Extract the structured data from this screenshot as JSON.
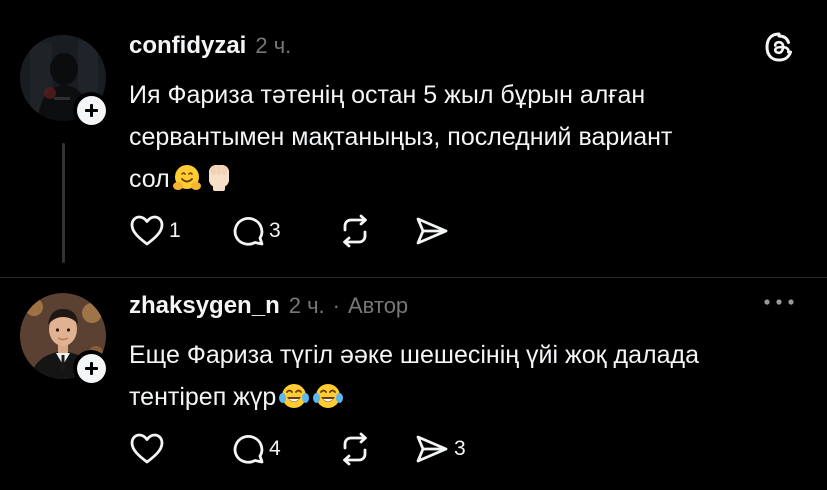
{
  "posts": [
    {
      "username": "confidyzai",
      "time": "2 ч.",
      "author_tag": "",
      "text_lines": [
        "Ия Фариза тәтенің остан 5 жыл бұрын алған",
        "сервантымен мақтаныңыз, последний вариант",
        "сол"
      ],
      "emojis": [
        "hugging-face-emoji",
        "raised-fist-emoji"
      ],
      "likes": "1",
      "replies": "3",
      "reposts": "",
      "shares": ""
    },
    {
      "username": "zhaksygen_n",
      "time": "2 ч.",
      "separator": "·",
      "author_tag": "Автор",
      "text_lines": [
        "Еще Фариза түгіл әәке шешесінің үйі жоқ далада",
        "тентіреп жүр"
      ],
      "emojis": [
        "tears-of-joy-emoji",
        "tears-of-joy-emoji"
      ],
      "likes": "",
      "replies": "4",
      "reposts": "",
      "shares": "3"
    }
  ],
  "icons": {
    "platform": "threads-logo-icon",
    "follow": "plus-icon",
    "like": "heart-icon",
    "reply": "speech-bubble-icon",
    "repost": "repost-icon",
    "share": "send-icon",
    "more": "more-dots-icon"
  },
  "colors": {
    "background": "#000000",
    "text": "#f3f5f7",
    "muted": "#777777",
    "thread_line": "#333333"
  }
}
